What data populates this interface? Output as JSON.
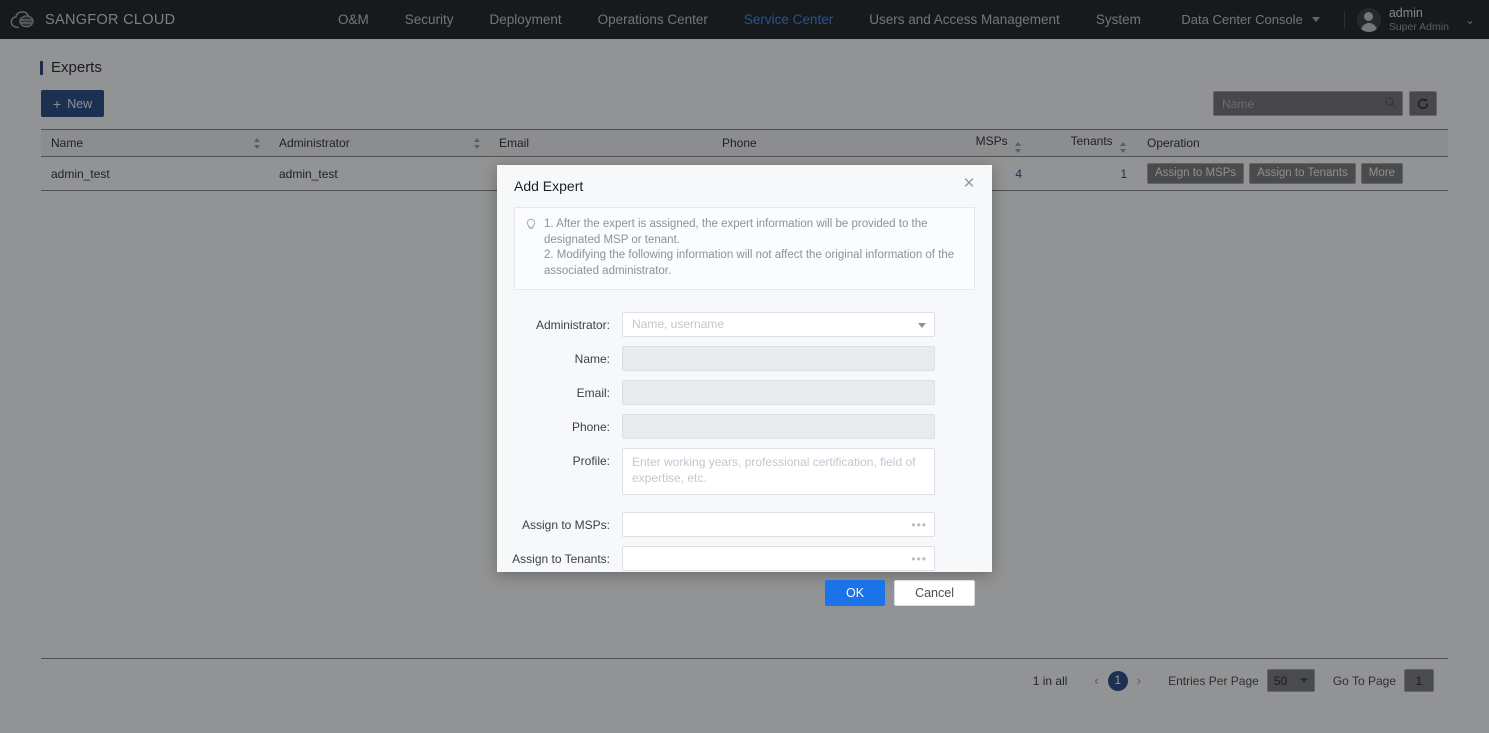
{
  "topnav": {
    "brand": "SANGFOR CLOUD",
    "logo_icon": "cloud-logo-icon",
    "items": [
      {
        "label": "O&M",
        "active": false
      },
      {
        "label": "Security",
        "active": false
      },
      {
        "label": "Deployment",
        "active": false
      },
      {
        "label": "Operations Center",
        "active": false
      },
      {
        "label": "Service Center",
        "active": true
      },
      {
        "label": "Users and Access Management",
        "active": false
      },
      {
        "label": "System",
        "active": false
      }
    ],
    "console_selector": "Data Center Console",
    "user": {
      "name": "admin",
      "role": "Super Admin"
    },
    "accent_active": "#2e7fe0"
  },
  "page": {
    "title": "Experts",
    "new_button": "New",
    "new_button_icon": "plus-icon",
    "search_placeholder": "Name",
    "search_value": "",
    "search_icon": "search-icon",
    "refresh_icon": "refresh-icon"
  },
  "table": {
    "columns": [
      {
        "label": "Name",
        "sortable": true,
        "align": "left"
      },
      {
        "label": "Administrator",
        "sortable": true,
        "align": "left"
      },
      {
        "label": "Email",
        "sortable": false,
        "align": "left"
      },
      {
        "label": "Phone",
        "sortable": false,
        "align": "left"
      },
      {
        "label": "MSPs",
        "sortable": true,
        "align": "right"
      },
      {
        "label": "Tenants",
        "sortable": true,
        "align": "right"
      },
      {
        "label": "Operation",
        "sortable": false,
        "align": "left"
      }
    ],
    "rows": [
      {
        "name": "admin_test",
        "administrator": "admin_test",
        "email": "",
        "phone": "",
        "msps": "4",
        "tenants": "1",
        "operations": [
          "Assign to MSPs",
          "Assign to Tenants",
          "More"
        ]
      }
    ]
  },
  "pagination": {
    "total_text": "1 in all",
    "prev_icon": "chevron-left-icon",
    "next_icon": "chevron-right-icon",
    "current_page": "1",
    "entries_label": "Entries Per Page",
    "entries_value": "50",
    "goto_label": "Go To Page",
    "goto_value": "1"
  },
  "modal": {
    "title": "Add Expert",
    "close_icon": "close-icon",
    "tip_icon": "lightbulb-icon",
    "tip_line1": "1. After the expert is assigned, the expert information will be provided to the designated MSP or tenant.",
    "tip_line2": "2. Modifying the following information will not affect the original information of the associated administrator.",
    "fields": [
      {
        "label": "Administrator:",
        "type": "select",
        "value": "",
        "placeholder": "Name, username",
        "disabled": false
      },
      {
        "label": "Name:",
        "type": "text",
        "value": "",
        "placeholder": "",
        "disabled": true
      },
      {
        "label": "Email:",
        "type": "text",
        "value": "",
        "placeholder": "",
        "disabled": true
      },
      {
        "label": "Phone:",
        "type": "text",
        "value": "",
        "placeholder": "",
        "disabled": true
      },
      {
        "label": "Profile:",
        "type": "textarea",
        "value": "",
        "placeholder": "Enter working years, professional certification, field of expertise, etc.",
        "disabled": false
      },
      {
        "label": "Assign to MSPs:",
        "type": "picker",
        "value": "",
        "placeholder": "",
        "disabled": false
      },
      {
        "label": "Assign to Tenants:",
        "type": "picker",
        "value": "",
        "placeholder": "",
        "disabled": false
      }
    ],
    "ok_label": "OK",
    "cancel_label": "Cancel",
    "ok_color": "#1a73e8"
  }
}
